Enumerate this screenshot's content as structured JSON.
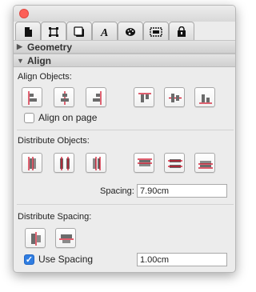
{
  "tabs": [
    {
      "icon": "document-icon"
    },
    {
      "icon": "geometry-icon",
      "active": true
    },
    {
      "icon": "shadow-icon"
    },
    {
      "icon": "text-icon"
    },
    {
      "icon": "palette-icon"
    },
    {
      "icon": "image-icon"
    },
    {
      "icon": "lock-icon"
    }
  ],
  "sections": {
    "geometry": {
      "label": "Geometry",
      "expanded": false
    },
    "align": {
      "label": "Align",
      "expanded": true
    }
  },
  "align_objects": {
    "label": "Align Objects:"
  },
  "align_on_page": {
    "label": "Align on page",
    "checked": false
  },
  "distribute_objects": {
    "label": "Distribute Objects:"
  },
  "spacing": {
    "label": "Spacing:",
    "value": "7.90cm"
  },
  "distribute_spacing": {
    "label": "Distribute Spacing:"
  },
  "use_spacing": {
    "label": "Use Spacing",
    "checked": true,
    "value": "1.00cm"
  },
  "colors": {
    "accent": "#2f7de1",
    "guide": "#d0021b",
    "close": "#fc5f57"
  }
}
